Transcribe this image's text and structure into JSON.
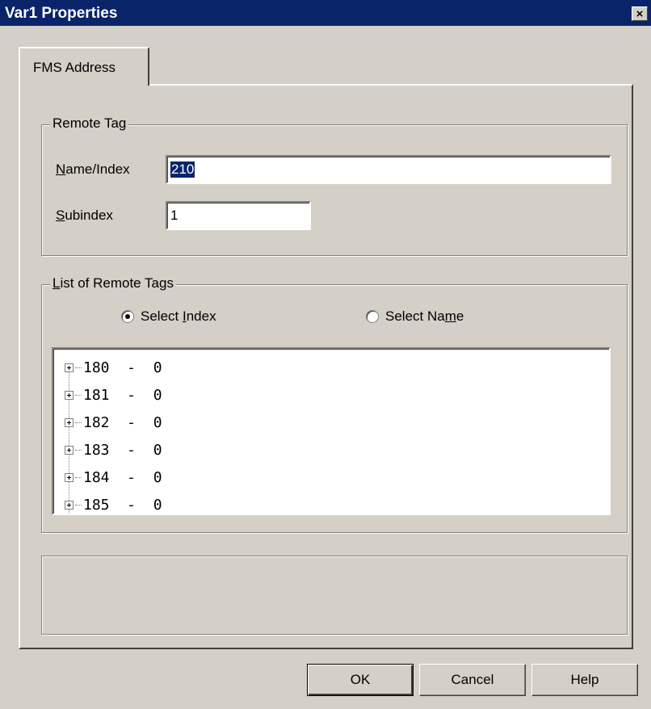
{
  "window": {
    "title": "Var1 Properties",
    "close_glyph": "×"
  },
  "tabs": [
    {
      "label": "FMS Address",
      "active": true
    }
  ],
  "remote_tag": {
    "legend": "Remote Tag",
    "name_index": {
      "label_u": "N",
      "label_rest": "ame/Index",
      "value": "210"
    },
    "subindex": {
      "label_u": "S",
      "label_rest": "ubindex",
      "value": "1"
    }
  },
  "list": {
    "legend_u": "L",
    "legend_rest": "ist of Remote Tags",
    "radio_index": {
      "label_pre": "Select ",
      "label_u": "I",
      "label_post": "ndex",
      "checked": true
    },
    "radio_name": {
      "label_pre": "Select Na",
      "label_u": "m",
      "label_post": "e",
      "checked": false
    },
    "items": [
      "180  -  0",
      "181  -  0",
      "182  -  0",
      "183  -  0",
      "184  -  0",
      "185  -  0"
    ]
  },
  "buttons": {
    "ok": "OK",
    "cancel": "Cancel",
    "help": "Help"
  },
  "icons": {
    "close": "close-icon",
    "expand": "plus-box-icon",
    "radio": "radio-icon"
  }
}
